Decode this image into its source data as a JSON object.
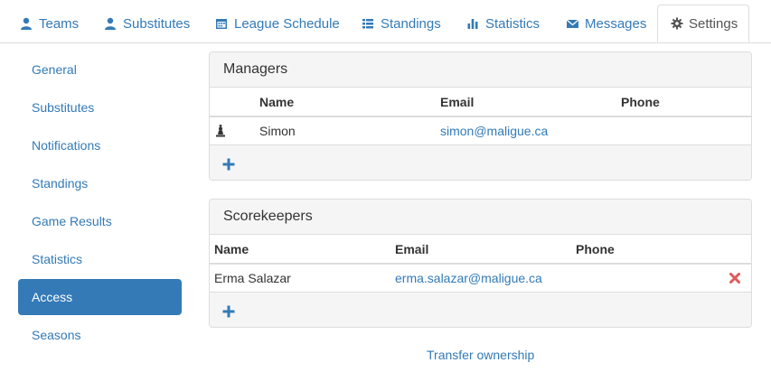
{
  "tabs": [
    {
      "label": "Teams",
      "icon": "user-icon"
    },
    {
      "label": "Substitutes",
      "icon": "user-icon"
    },
    {
      "label": "League Schedule",
      "icon": "calendar-icon"
    },
    {
      "label": "Standings",
      "icon": "list-icon"
    },
    {
      "label": "Statistics",
      "icon": "bar-chart-icon"
    },
    {
      "label": "Messages",
      "icon": "envelope-icon"
    },
    {
      "label": "Settings",
      "icon": "gear-icon",
      "active": true
    }
  ],
  "sidebar": {
    "items": [
      {
        "label": "General"
      },
      {
        "label": "Substitutes"
      },
      {
        "label": "Notifications"
      },
      {
        "label": "Standings"
      },
      {
        "label": "Game Results"
      },
      {
        "label": "Statistics"
      },
      {
        "label": "Access",
        "active": true
      },
      {
        "label": "Seasons"
      }
    ]
  },
  "managers": {
    "title": "Managers",
    "columns": [
      "Name",
      "Email",
      "Phone"
    ],
    "rows": [
      {
        "name": "Simon",
        "email": "simon@maligue.ca",
        "phone": "",
        "icon": "owner-icon"
      }
    ],
    "add_icon": "plus-icon"
  },
  "scorekeepers": {
    "title": "Scorekeepers",
    "columns": [
      "Name",
      "Email",
      "Phone"
    ],
    "rows": [
      {
        "name": "Erma Salazar",
        "email": "erma.salazar@maligue.ca",
        "phone": "",
        "remove_icon": "remove-icon"
      }
    ],
    "add_icon": "plus-icon"
  },
  "transfer_link": "Transfer ownership",
  "colors": {
    "link": "#337ab7",
    "active_bg": "#337ab7",
    "remove": "#e05a5a",
    "panel_heading_bg": "#f5f5f5"
  }
}
